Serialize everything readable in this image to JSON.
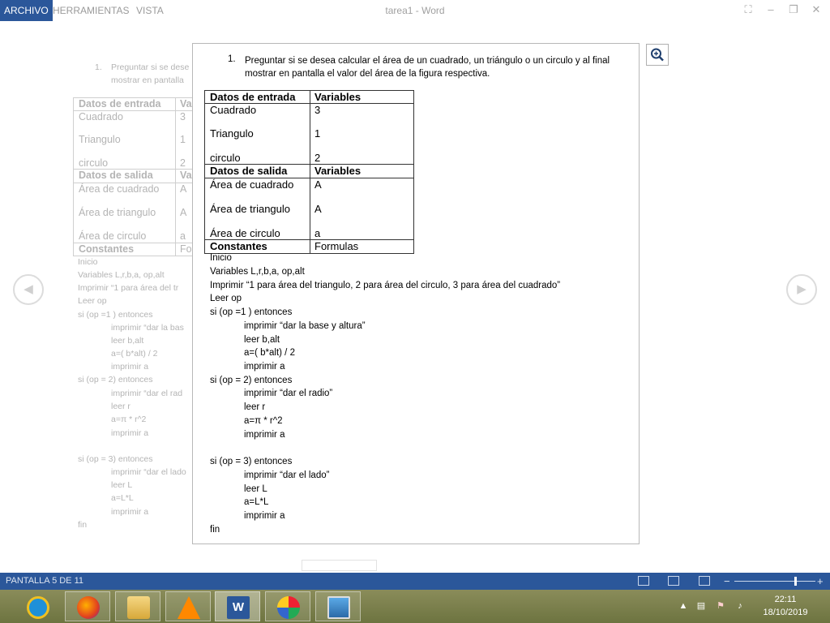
{
  "menu": {
    "file": "ARCHIVO",
    "tools": "HERRAMIENTAS",
    "view": "VISTA"
  },
  "window": {
    "title": "tarea1 - Word"
  },
  "document": {
    "question_number": "1.",
    "question": "Preguntar si se desea calcular el área de un cuadrado, un triángulo o un circulo y al final mostrar en pantalla el valor del área de la figura respectiva.",
    "question_line1": "Preguntar si se desea calcular el área de un cuadrado, un triángulo o un circulo y al final",
    "question_line2": "mostrar en pantalla el valor del área de la figura respectiva.",
    "table": {
      "input_header": "Datos de entrada",
      "variables_header": "Variables",
      "inputs": [
        {
          "label": "Cuadrado",
          "value": "3"
        },
        {
          "label": "Triangulo",
          "value": "1"
        },
        {
          "label": "circulo",
          "value": "2"
        }
      ],
      "output_header": "Datos de salida",
      "variables_header_2": "Variables",
      "outputs": [
        {
          "label": "Área de cuadrado",
          "value": "A"
        },
        {
          "label": "Área de triangulo",
          "value": "A"
        },
        {
          "label": "Área de circulo",
          "value": "a"
        }
      ],
      "constants_header": "Constantes",
      "formulas_header": "Formulas"
    },
    "algorithm": [
      "Inicio",
      "Variables L,r,b,a, op,alt",
      "Imprimir “1 para área del triangulo, 2 para área del circulo, 3 para área del cuadrado”",
      "Leer  op",
      "si  (op =1 ) entonces",
      "imprimir “dar la base y altura”",
      "leer b,alt",
      "a=( b*alt) / 2",
      "imprimir  a",
      "si  (op = 2) entonces",
      "imprimir “dar el radio”",
      "leer    r",
      "a=π * r^2",
      "imprimir  a",
      "si  (op = 3) entonces",
      "imprimir “dar el lado”",
      "leer   L",
      "a=L*L",
      "imprimir  a",
      "fin"
    ],
    "background_question_fragment_1": "Preguntar si se dese",
    "background_question_fragment_2": "mostrar en pantalla",
    "background_table_fragments": [
      "Va",
      "3",
      "1",
      "2",
      "Va",
      "A",
      "A",
      "a",
      "Fo"
    ],
    "background_algorithm_fragments": {
      "print_line": "Imprimir “1 para área del tr",
      "base": "imprimir “dar la bas",
      "radio": "imprimir “dar el rad",
      "lado": "imprimir “dar el lado"
    }
  },
  "status": {
    "page": "PANTALLA 5 DE 11",
    "zoom_minus": "−",
    "zoom_plus": "+",
    "zoom_level": 0.75
  },
  "taskbar": {
    "apps": [
      "internet-explorer",
      "firefox",
      "file-explorer",
      "vlc",
      "word",
      "paint",
      "photos"
    ],
    "time": "22:11",
    "date": "18/10/2019"
  }
}
